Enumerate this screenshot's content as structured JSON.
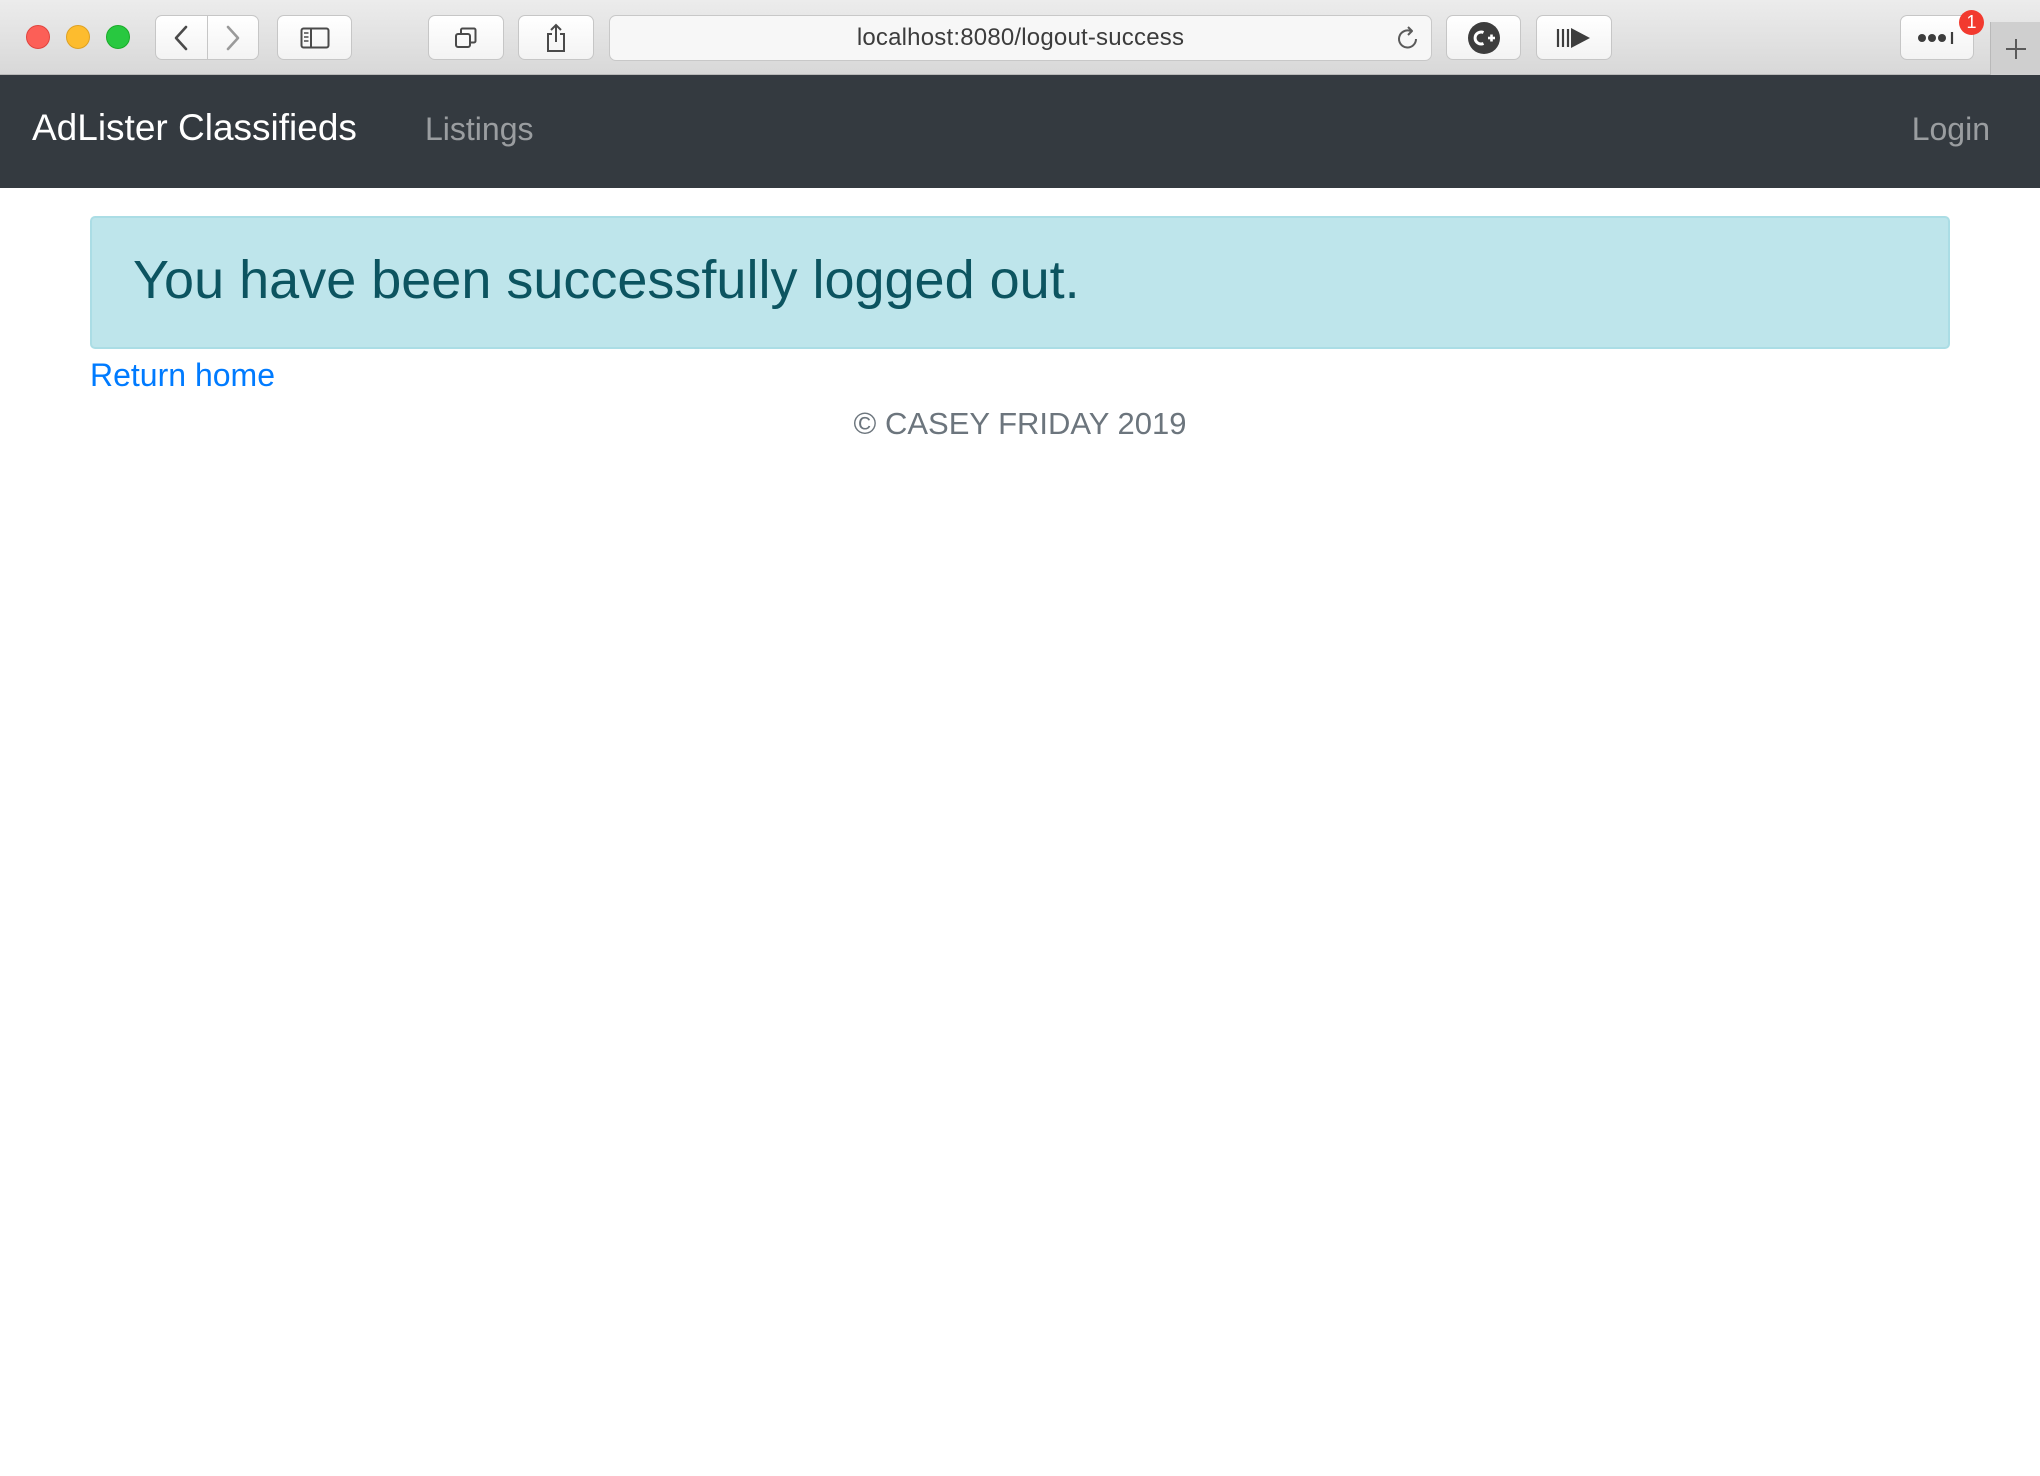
{
  "browser": {
    "url": "localhost:8080/logout-success",
    "notification_count": "1"
  },
  "navbar": {
    "brand": "AdLister Classifieds",
    "listings_label": "Listings",
    "login_label": "Login",
    "background_color": "#343a40"
  },
  "alert": {
    "message": "You have been successfully logged out.",
    "background_color": "#bee5eb",
    "text_color": "#0c5460"
  },
  "links": {
    "return_home": "Return home"
  },
  "footer": {
    "text": "© CASEY FRIDAY 2019"
  },
  "icons": {
    "back": "chevron-left-icon",
    "forward": "chevron-right-icon",
    "sidebar": "sidebar-icon",
    "tabs": "tab-overview-icon",
    "share": "share-icon",
    "reload": "reload-icon",
    "extension": "c-plus-extension-icon",
    "reader": "reader-play-icon",
    "more": "more-icon",
    "new_tab": "plus-icon"
  }
}
